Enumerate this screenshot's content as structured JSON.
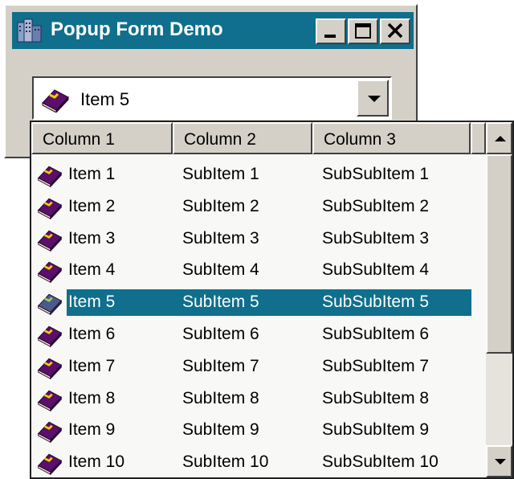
{
  "window": {
    "title": "Popup Form Demo",
    "app_icon": "building-icon",
    "controls": [
      "minimize-icon",
      "maximize-icon",
      "close-icon"
    ]
  },
  "combo": {
    "selected_text": "Item 5",
    "icon": "book-icon",
    "dropdown_icon": "chevron-down-icon"
  },
  "list": {
    "columns": [
      "Column 1",
      "Column 2",
      "Column 3"
    ],
    "rows": [
      [
        "Item 1",
        "SubItem 1",
        "SubSubItem 1"
      ],
      [
        "Item 2",
        "SubItem 2",
        "SubSubItem 2"
      ],
      [
        "Item 3",
        "SubItem 3",
        "SubSubItem 3"
      ],
      [
        "Item 4",
        "SubItem 4",
        "SubSubItem 4"
      ],
      [
        "Item 5",
        "SubItem 5",
        "SubSubItem 5"
      ],
      [
        "Item 6",
        "SubItem 6",
        "SubSubItem 6"
      ],
      [
        "Item 7",
        "SubItem 7",
        "SubSubItem 7"
      ],
      [
        "Item 8",
        "SubItem 8",
        "SubSubItem 8"
      ],
      [
        "Item 9",
        "SubItem 9",
        "SubSubItem 9"
      ],
      [
        "Item 10",
        "SubItem 10",
        "SubSubItem 10"
      ]
    ],
    "selected_index": 4,
    "row_icon": "book-icon"
  },
  "colors": {
    "title_bar": "#0f6f8c",
    "selection": "#0f6f8c",
    "face": "#d4d0c8"
  }
}
